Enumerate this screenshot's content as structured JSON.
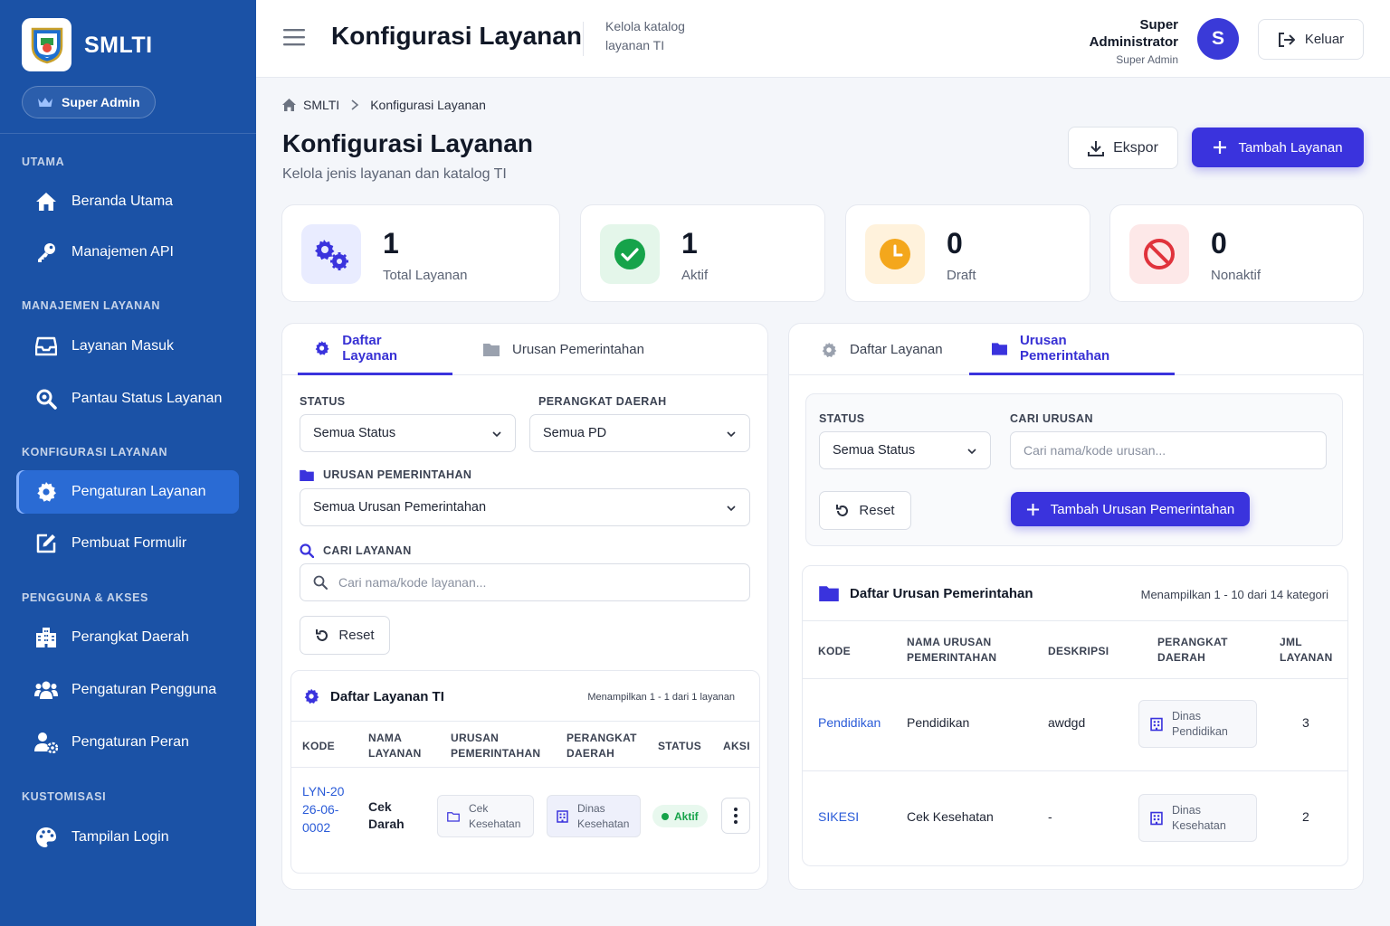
{
  "sidebar": {
    "brand": "SMLTI",
    "role_pill": "Super Admin",
    "sections": {
      "utama": "UTAMA",
      "manajemen": "MANAJEMEN LAYANAN",
      "konfigurasi": "KONFIGURASI LAYANAN",
      "pengguna": "PENGGUNA & AKSES",
      "kustomisasi": "KUSTOMISASI"
    },
    "items": [
      {
        "label": "Beranda Utama",
        "icon": "home-icon"
      },
      {
        "label": "Manajemen API",
        "icon": "key-icon"
      },
      {
        "label": "Layanan Masuk",
        "icon": "inbox-icon"
      },
      {
        "label": "Pantau Status Layanan",
        "icon": "search-icon"
      },
      {
        "label": "Pengaturan Layanan",
        "icon": "gear-icon",
        "active": true
      },
      {
        "label": "Pembuat Formulir",
        "icon": "edit-icon"
      },
      {
        "label": "Perangkat Daerah",
        "icon": "building-icon"
      },
      {
        "label": "Pengaturan Pengguna",
        "icon": "users-icon"
      },
      {
        "label": "Pengaturan Peran",
        "icon": "user-gear-icon"
      },
      {
        "label": "Tampilan Login",
        "icon": "palette-icon"
      }
    ]
  },
  "header": {
    "title": "Konfigurasi Layanan",
    "subtitle": "Kelola katalog layanan TI",
    "user_name": "Super Administrator",
    "user_role": "Super Admin",
    "avatar_initial": "S",
    "logout_label": "Keluar"
  },
  "breadcrumb": {
    "root": "SMLTI",
    "current": "Konfigurasi Layanan"
  },
  "page": {
    "title": "Konfigurasi Layanan",
    "subtitle": "Kelola jenis layanan dan katalog TI",
    "export_label": "Ekspor",
    "add_label": "Tambah Layanan"
  },
  "stats": [
    {
      "value": "1",
      "label": "Total Layanan"
    },
    {
      "value": "1",
      "label": "Aktif"
    },
    {
      "value": "0",
      "label": "Draft"
    },
    {
      "value": "0",
      "label": "Nonaktif"
    }
  ],
  "left_panel": {
    "tabs": [
      "Daftar Layanan",
      "Urusan Pemerintahan"
    ],
    "status_label": "STATUS",
    "status_value": "Semua Status",
    "pd_label": "PERANGKAT DAERAH",
    "pd_value": "Semua PD",
    "urusan_label": "URUSAN PEMERINTAHAN",
    "urusan_value": "Semua Urusan Pemerintahan",
    "search_label": "CARI LAYANAN",
    "search_placeholder": "Cari nama/kode layanan...",
    "reset_label": "Reset",
    "card_title": "Daftar Layanan TI",
    "card_meta": "Menampilkan 1 - 1 dari 1 layanan",
    "columns": [
      "KODE",
      "NAMA LAYANAN",
      "URUSAN PEMERINTAHAN",
      "PERANGKAT DAERAH",
      "STATUS",
      "AKSI"
    ],
    "rows": [
      {
        "kode": "LYN-2026-06-0002",
        "nama": "Cek Darah",
        "urusan": "Cek Kesehatan",
        "pd": "Dinas Kesehatan",
        "status": "Aktif"
      }
    ]
  },
  "right_panel": {
    "tabs": [
      "Daftar Layanan",
      "Urusan Pemerintahan"
    ],
    "status_label": "STATUS",
    "status_value": "Semua Status",
    "search_label": "CARI URUSAN",
    "search_placeholder": "Cari nama/kode urusan...",
    "reset_label": "Reset",
    "add_label": "Tambah Urusan Pemerintahan",
    "card_title": "Daftar Urusan Pemerintahan",
    "card_meta": "Menampilkan 1 - 10 dari 14 kategori",
    "columns": [
      "KODE",
      "NAMA URUSAN PEMERINTAHAN",
      "DESKRIPSI",
      "PERANGKAT DAERAH",
      "JML LAYANAN"
    ],
    "rows": [
      {
        "kode": "Pendidikan",
        "nama": "Pendidikan",
        "deskripsi": "awdgd",
        "pd": "Dinas Pendidikan",
        "jml": "3"
      },
      {
        "kode": "SIKESI",
        "nama": "Cek Kesehatan",
        "deskripsi": "-",
        "pd": "Dinas Kesehatan",
        "jml": "2"
      }
    ]
  },
  "colors": {
    "sidebar": "#1b52a6",
    "primary": "#3a33dd",
    "success": "#16a34a",
    "warning": "#f4a71c",
    "danger": "#e0333c"
  }
}
